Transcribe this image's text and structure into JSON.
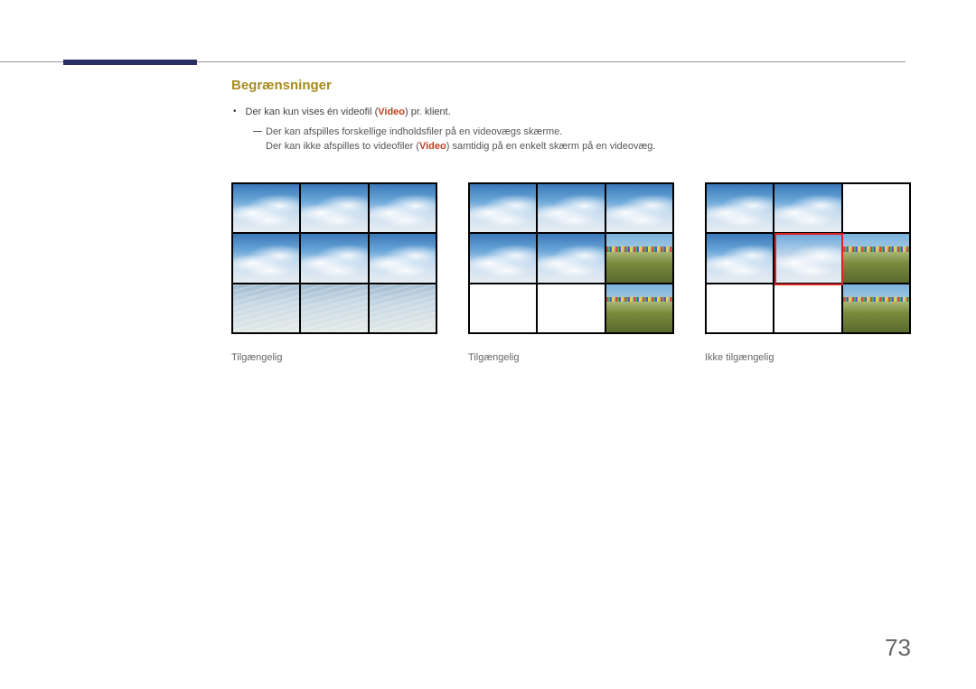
{
  "section": {
    "heading": "Begrænsninger",
    "bullet": {
      "pre": "Der kan kun vises én videofil (",
      "accent": "Video",
      "post": ") pr. klient."
    },
    "sub1": "Der kan afspilles forskellige indholdsfiler på en videovægs skærme.",
    "sub2": {
      "pre": "Der kan ikke afspilles to videofiler (",
      "accent": "Video",
      "post": ") samtidig på en enkelt skærm på en videovæg."
    }
  },
  "captions": {
    "c1": "Tilgængelig",
    "c2": "Tilgængelig",
    "c3": "Ikke tilgængelig"
  },
  "page_number": "73"
}
